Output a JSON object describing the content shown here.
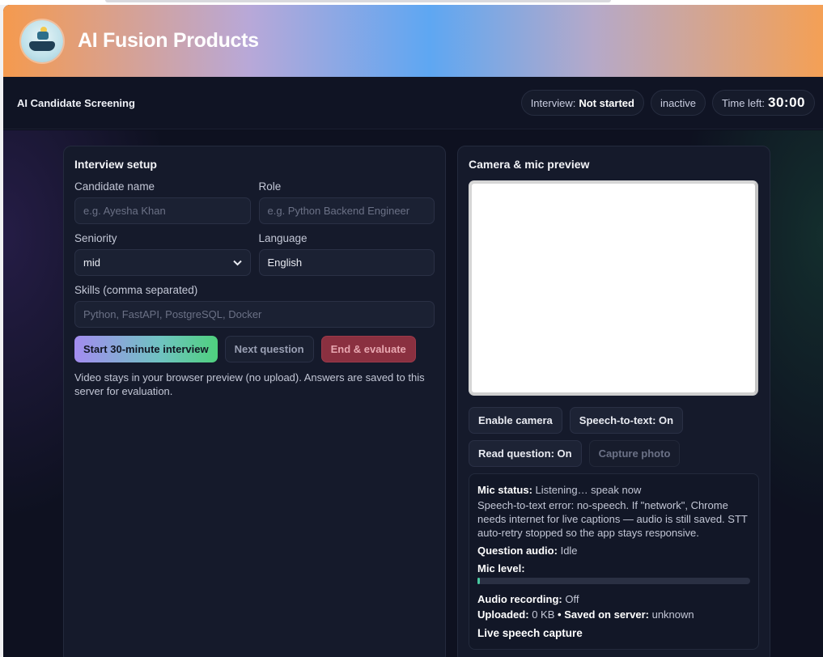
{
  "brand": {
    "title": "AI Fusion Products"
  },
  "header": {
    "title": "AI Candidate Screening",
    "interview_label": "Interview:",
    "interview_status": "Not started",
    "activity": "inactive",
    "time_label": "Time left:",
    "time_value": "30:00"
  },
  "setup": {
    "title": "Interview setup",
    "candidate_label": "Candidate name",
    "candidate_placeholder": "e.g. Ayesha Khan",
    "role_label": "Role",
    "role_placeholder": "e.g. Python Backend Engineer",
    "seniority_label": "Seniority",
    "seniority_value": "mid",
    "language_label": "Language",
    "language_value": "English",
    "skills_label": "Skills (comma separated)",
    "skills_placeholder": "Python, FastAPI, PostgreSQL, Docker",
    "start_button": "Start 30-minute interview",
    "next_button": "Next question",
    "end_button": "End & evaluate",
    "note": "Video stays in your browser preview (no upload). Answers are saved to this server for evaluation."
  },
  "camera": {
    "title": "Camera & mic preview",
    "enable_button": "Enable camera",
    "stt_button": "Speech-to-text: On",
    "read_button": "Read question: On",
    "capture_button": "Capture photo"
  },
  "status": {
    "mic_label": "Mic status:",
    "mic_value": "Listening… speak now",
    "stt_error": "Speech-to-text error: no-speech. If \"network\", Chrome needs internet for live captions — audio is still saved. STT auto-retry stopped so the app stays responsive.",
    "question_audio_label": "Question audio:",
    "question_audio_value": "Idle",
    "mic_level_label": "Mic level:",
    "mic_level": 0.01,
    "recording_label": "Audio recording:",
    "recording_value": "Off",
    "uploaded_label": "Uploaded:",
    "uploaded_value": "0 KB",
    "bullet": "•",
    "saved_label": "Saved on server:",
    "saved_value": "unknown",
    "live_capture": "Live speech capture"
  },
  "colors": {
    "accent_green": "#4fd07e",
    "accent_purple": "#a38cf0",
    "danger": "#8a3040",
    "background": "#0e1120"
  },
  "icons": {
    "logo": "ai-hand-logo",
    "select_chevron": "chevron-down-icon"
  }
}
